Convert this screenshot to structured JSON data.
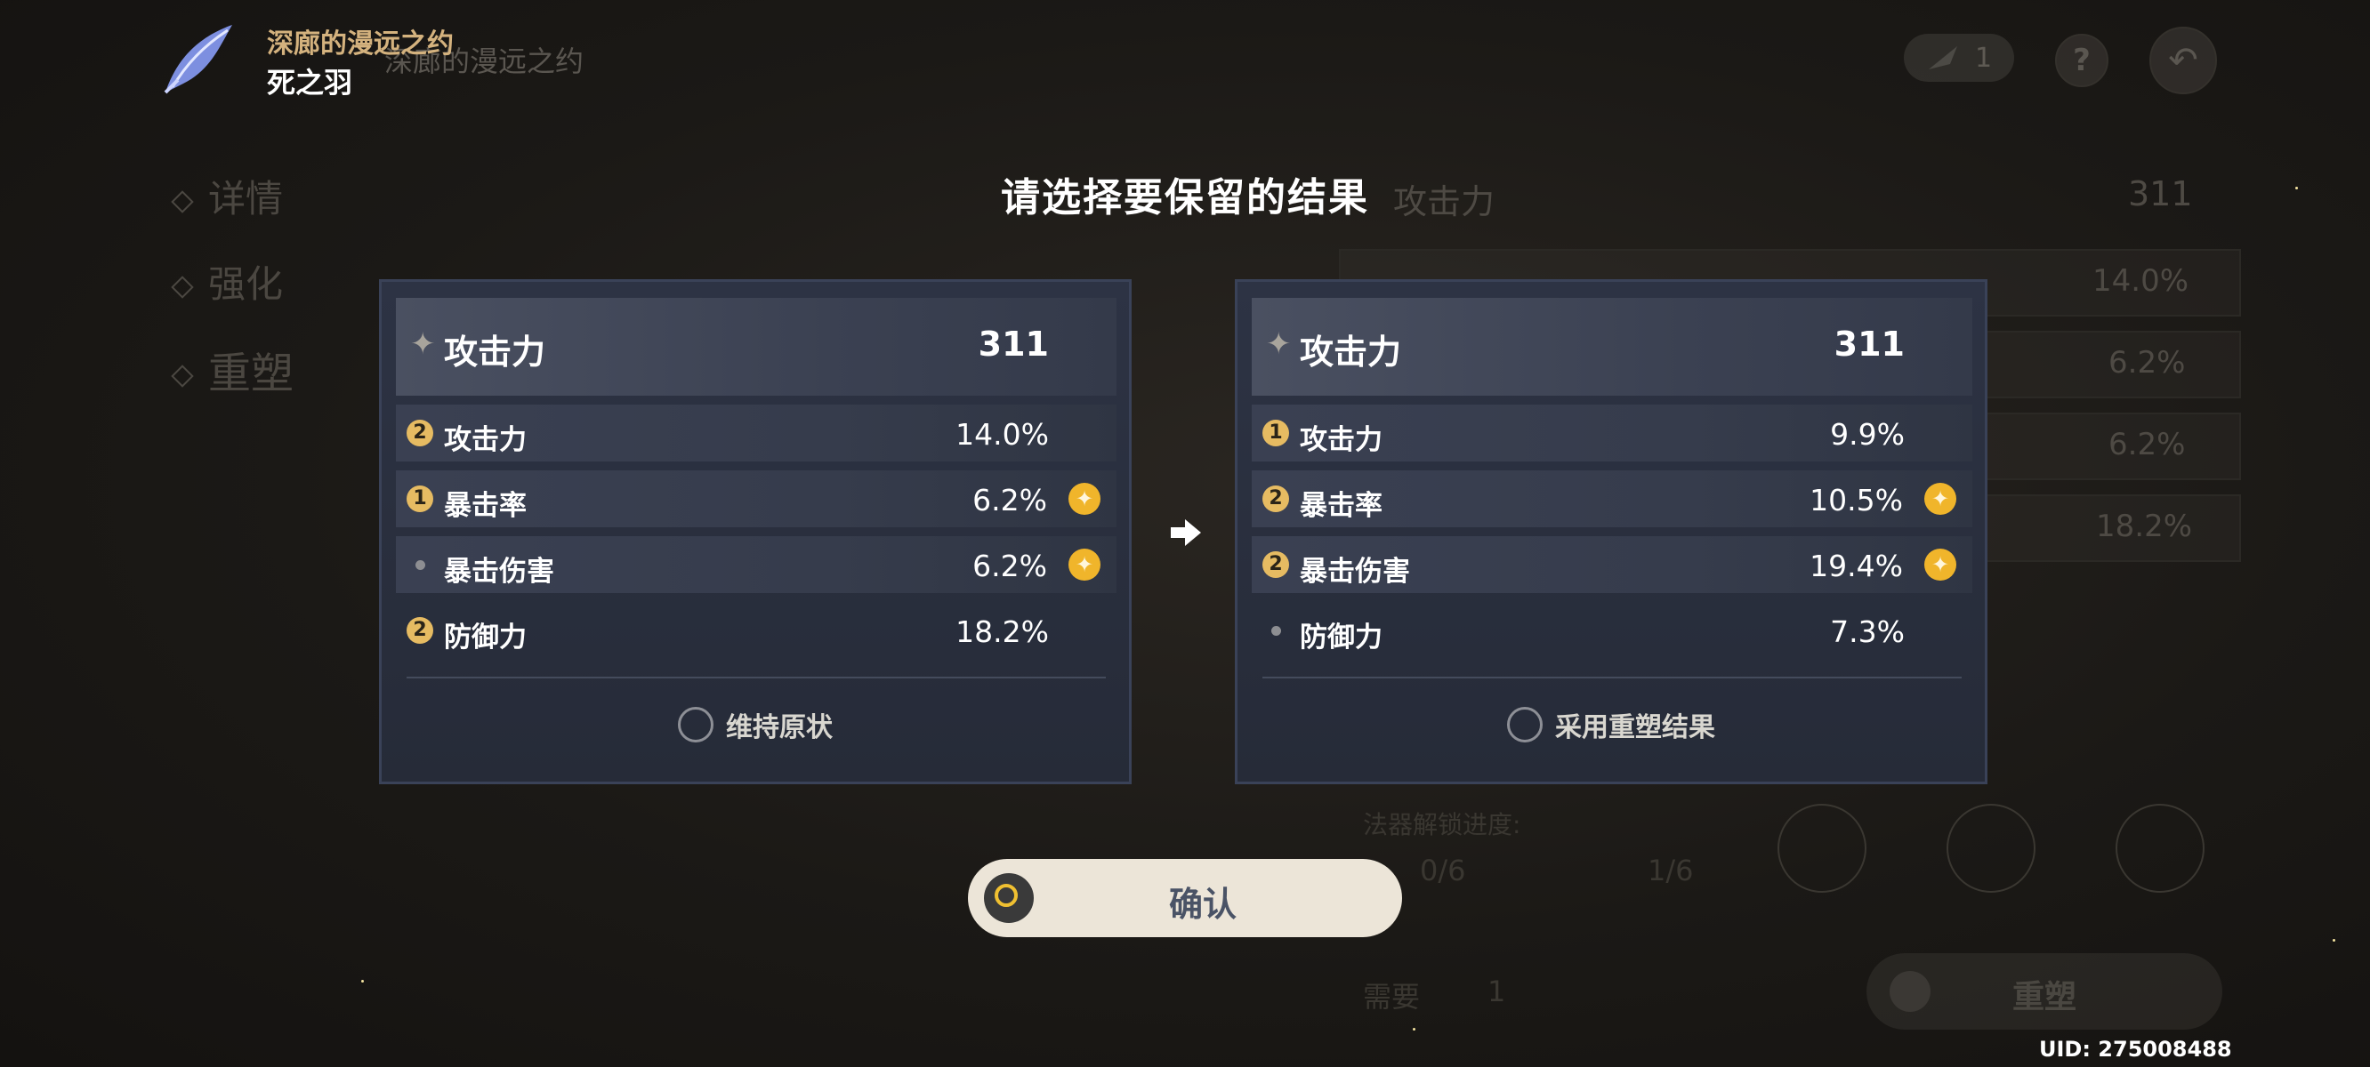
{
  "header": {
    "set_name": "深廊的漫远之约",
    "piece_name": "死之羽",
    "background_set_name": "深廊的漫远之约",
    "material_count": "1"
  },
  "background": {
    "nav": [
      "详情",
      "强化",
      "重塑"
    ],
    "panel": {
      "main_stat": "攻击力",
      "main_value": "311",
      "sub_values": [
        "14.0%",
        "6.2%",
        "6.2%",
        "18.2%"
      ]
    },
    "progress_label": "法器解锁进度:",
    "progress_current": "0/6",
    "progress_next": "1/6",
    "need_label": "需要",
    "need_count": "1",
    "reshape_button": "重塑"
  },
  "modal": {
    "title": "请选择要保留的结果",
    "left": {
      "main_stat": {
        "name": "攻击力",
        "value": "311"
      },
      "substats": [
        {
          "badge": "2",
          "name": "攻击力",
          "value": "14.0%",
          "highlight": false
        },
        {
          "badge": "1",
          "name": "暴击率",
          "value": "6.2%",
          "highlight": true
        },
        {
          "badge": "",
          "name": "暴击伤害",
          "value": "6.2%",
          "highlight": true
        },
        {
          "badge": "2",
          "name": "防御力",
          "value": "18.2%",
          "highlight": false
        }
      ],
      "option_label": "维持原状"
    },
    "right": {
      "main_stat": {
        "name": "攻击力",
        "value": "311"
      },
      "substats": [
        {
          "badge": "1",
          "name": "攻击力",
          "value": "9.9%",
          "highlight": false
        },
        {
          "badge": "2",
          "name": "暴击率",
          "value": "10.5%",
          "highlight": true
        },
        {
          "badge": "2",
          "name": "暴击伤害",
          "value": "19.4%",
          "highlight": true
        },
        {
          "badge": "",
          "name": "防御力",
          "value": "7.3%",
          "highlight": false
        }
      ],
      "option_label": "采用重塑结果"
    },
    "confirm_label": "确认"
  },
  "uid": "UID: 275008488",
  "colors": {
    "accent_gold": "#e6bb62",
    "highlight_orange": "#f0b52b",
    "confirm_bg": "#ece5d8",
    "card_bg": "#2d3344"
  }
}
